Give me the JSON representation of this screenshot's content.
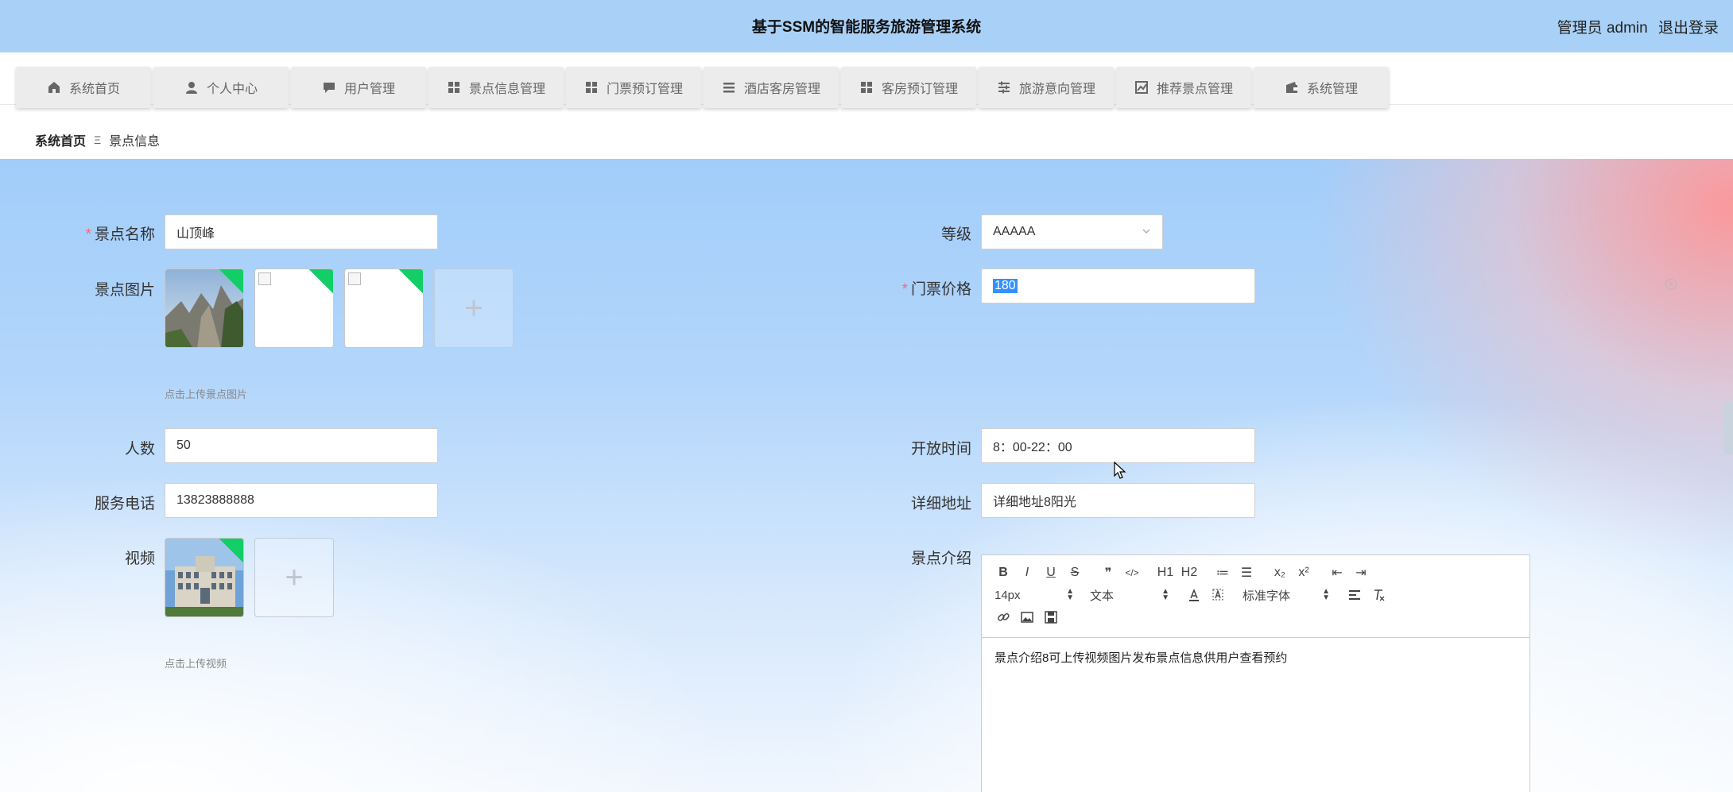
{
  "header": {
    "title": "基于SSM的智能服务旅游管理系统",
    "user_label": "管理员 admin",
    "logout_label": "退出登录"
  },
  "nav": {
    "items": [
      {
        "label": "系统首页",
        "icon": "home-icon"
      },
      {
        "label": "个人中心",
        "icon": "user-icon"
      },
      {
        "label": "用户管理",
        "icon": "chat-icon"
      },
      {
        "label": "景点信息管理",
        "icon": "grid-icon"
      },
      {
        "label": "门票预订管理",
        "icon": "grid-icon"
      },
      {
        "label": "酒店客房管理",
        "icon": "list-icon"
      },
      {
        "label": "客房预订管理",
        "icon": "grid-icon"
      },
      {
        "label": "旅游意向管理",
        "icon": "sliders-icon"
      },
      {
        "label": "推荐景点管理",
        "icon": "chart-icon"
      },
      {
        "label": "系统管理",
        "icon": "wallet-icon"
      }
    ]
  },
  "breadcrumb": {
    "home": "系统首页",
    "separator": "Ξ",
    "current": "景点信息"
  },
  "form": {
    "name_label": "景点名称",
    "name_value": "山顶峰",
    "level_label": "等级",
    "level_value": "AAAAA",
    "images_label": "景点图片",
    "images_hint": "点击上传景点图片",
    "price_label": "门票价格",
    "price_value": "180",
    "people_label": "人数",
    "people_value": "50",
    "open_label": "开放时间",
    "open_value": "8：00-22：00",
    "phone_label": "服务电话",
    "phone_value": "13823888888",
    "address_label": "详细地址",
    "address_value": "详细地址8阳光",
    "video_label": "视频",
    "video_hint": "点击上传视频",
    "intro_label": "景点介绍",
    "upload_plus": "+",
    "required_mark": "*"
  },
  "editor": {
    "toolbar_row1": [
      "B",
      "I",
      "U",
      "S",
      "❞",
      "</>",
      "H1",
      "H2",
      "≔",
      "☰",
      "x₂",
      "x²",
      "⇤",
      "⇥"
    ],
    "font_size": "14px",
    "block_type": "文本",
    "font_family": "标准字体",
    "content": "景点介绍8可上传视频图片发布景点信息供用户查看预约"
  },
  "colors": {
    "header_bg": "#a9d1f7",
    "required": "#f56c6c",
    "upload_badge": "#13ce66",
    "selection": "#3390ff"
  }
}
